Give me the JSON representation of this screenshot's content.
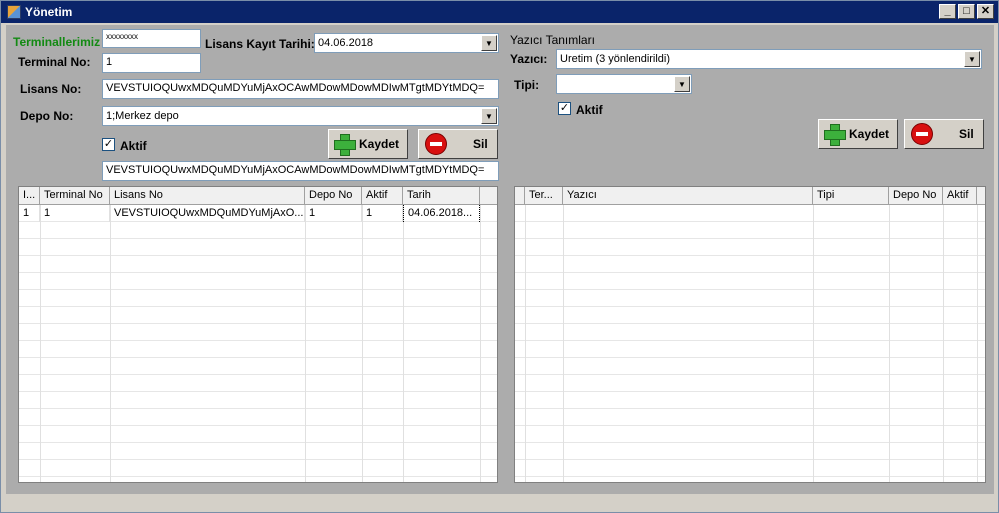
{
  "window": {
    "title": "Yönetim"
  },
  "left": {
    "terminallerimiz_label": "Terminallerimiz",
    "terminal_code_value": "xxxxxxxx",
    "terminal_no_label": "Terminal No:",
    "terminal_no_value": "1",
    "lisans_kayit_label": "Lisans Kayıt Tarihi:",
    "lisans_kayit_value": "04.06.2018",
    "lisans_no_label": "Lisans No:",
    "lisans_no_value": "VEVSTUIOQUwxMDQuMDYuMjAxOCAwMDowMDowMDIwMTgtMDYtMDQ=",
    "depo_no_label": "Depo No:",
    "depo_no_value": "1;Merkez depo",
    "aktif_label": "Aktif",
    "kaydet_label": "Kaydet",
    "sil_label": "Sil",
    "encoded_value": "VEVSTUIOQUwxMDQuMDYuMjAxOCAwMDowMDowMDIwMTgtMDYtMDQ=",
    "grid": {
      "columns": [
        "I...",
        "Terminal No",
        "Lisans No",
        "Depo No",
        "Aktif",
        "Tarih"
      ],
      "rows": [
        [
          "1",
          "1",
          "VEVSTUIOQUwxMDQuMDYuMjAxO...",
          "1",
          "1",
          "04.06.2018..."
        ]
      ]
    }
  },
  "right": {
    "section_title": "Yazıcı Tanımları",
    "yazici_label": "Yazıcı:",
    "yazici_value": "Uretim (3 yönlendirildi)",
    "tipi_label": "Tipi:",
    "tipi_value": "",
    "aktif_label": "Aktif",
    "kaydet_label": "Kaydet",
    "sil_label": "Sil",
    "grid": {
      "columns": [
        "Ter...",
        "Yazıcı",
        "Tipi",
        "Depo No",
        "Aktif"
      ]
    }
  }
}
